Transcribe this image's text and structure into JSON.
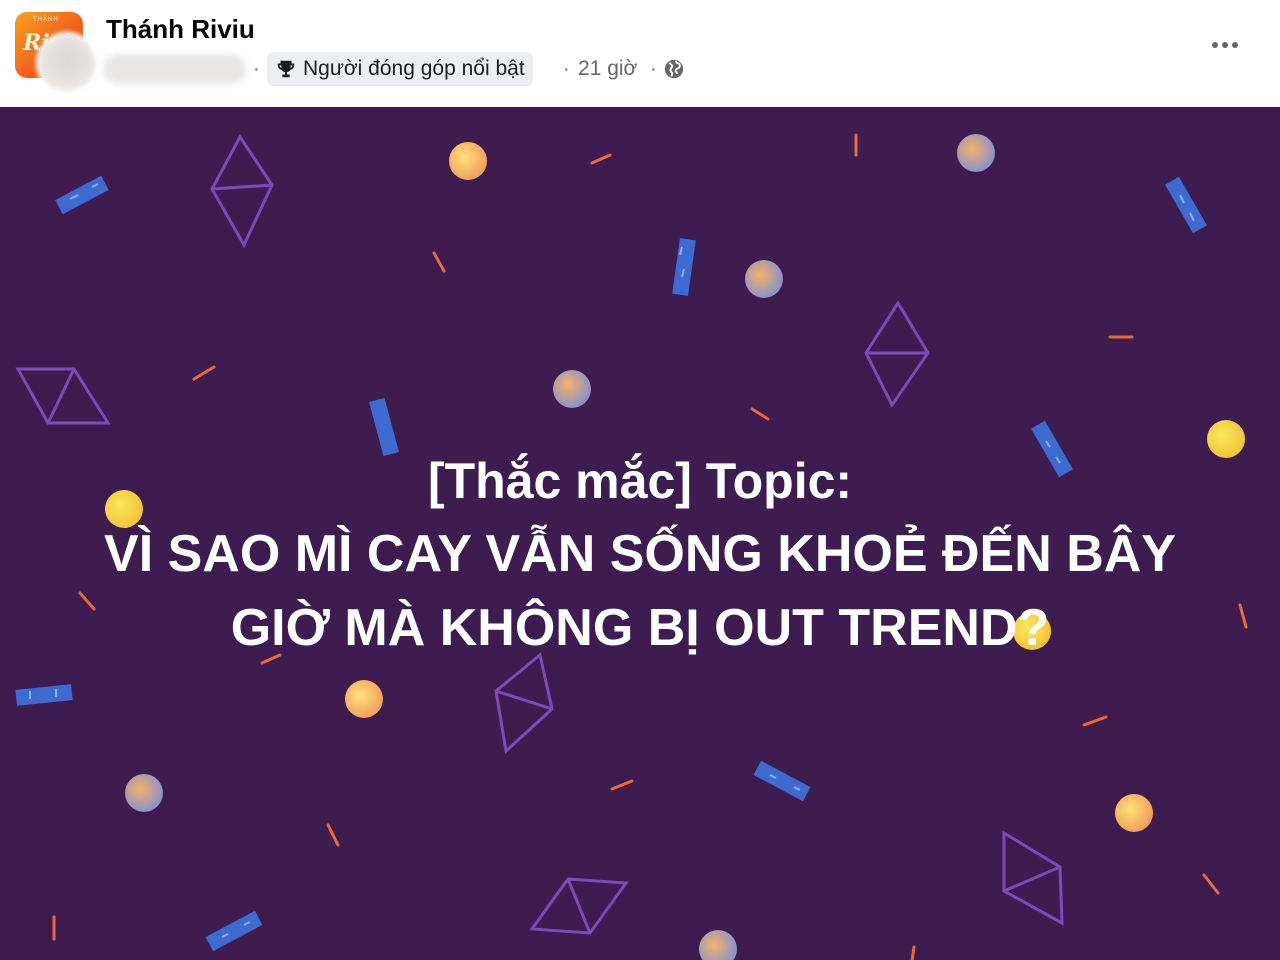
{
  "post": {
    "group_name": "Thánh Riviu",
    "group_logo_text": "Riviu",
    "group_logo_top_text": "THÁNH",
    "badge_label": "Người đóng góp nổi bật",
    "time_label": "21 giờ",
    "separator": "·",
    "icons": {
      "badge": "trophy-icon",
      "privacy": "globe-icon",
      "more": "more-options-icon"
    }
  },
  "content": {
    "title_line": "[Thắc mắc] Topic:",
    "body_line_1": "VÌ SAO MÌ CAY VẪN SỐNG KHOẺ ĐẾN BÂY",
    "body_line_2": "GIỜ MÀ KHÔNG BỊ OUT TREND?",
    "background_color": "#3e1c50",
    "text_color": "#ffffff"
  }
}
